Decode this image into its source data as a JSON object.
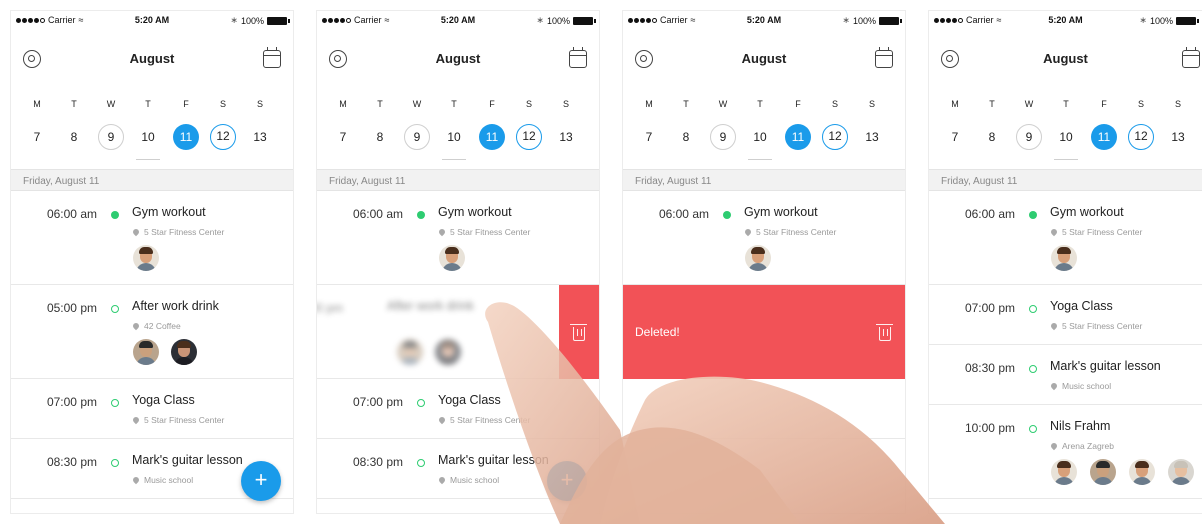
{
  "status": {
    "carrier": "Carrier",
    "time": "5:20 AM",
    "battery": "100%"
  },
  "header": {
    "month": "August"
  },
  "week": {
    "labels": [
      "M",
      "T",
      "W",
      "T",
      "F",
      "S",
      "S"
    ],
    "numbers": [
      "7",
      "8",
      "9",
      "10",
      "11",
      "12",
      "13"
    ],
    "selected": "11"
  },
  "date_label": "Friday, August 11",
  "events": {
    "gym": {
      "time": "06:00 am",
      "title": "Gym workout",
      "location": "5 Star Fitness Center"
    },
    "drink": {
      "time": "05:00 pm",
      "title": "After work drink",
      "location": "42 Coffee"
    },
    "yoga": {
      "time": "07:00 pm",
      "title": "Yoga Class",
      "location": "5 Star Fitness Center"
    },
    "guitar": {
      "time": "08:30 pm",
      "title": "Mark's guitar lesson",
      "location": "Music school"
    },
    "nils": {
      "time": "10:00 pm",
      "title": "Nils Frahm",
      "location": "Arena Zagreb"
    }
  },
  "deleted_label": "Deleted!",
  "fab_label": "+",
  "colors": {
    "accent": "#1a9bea",
    "event_dot": "#2ecc71",
    "delete": "#f25257"
  },
  "icons": [
    "target-icon",
    "calendar-icon",
    "pin-icon",
    "trash-icon",
    "plus-icon",
    "wifi-icon",
    "bluetooth-icon",
    "battery-icon"
  ]
}
